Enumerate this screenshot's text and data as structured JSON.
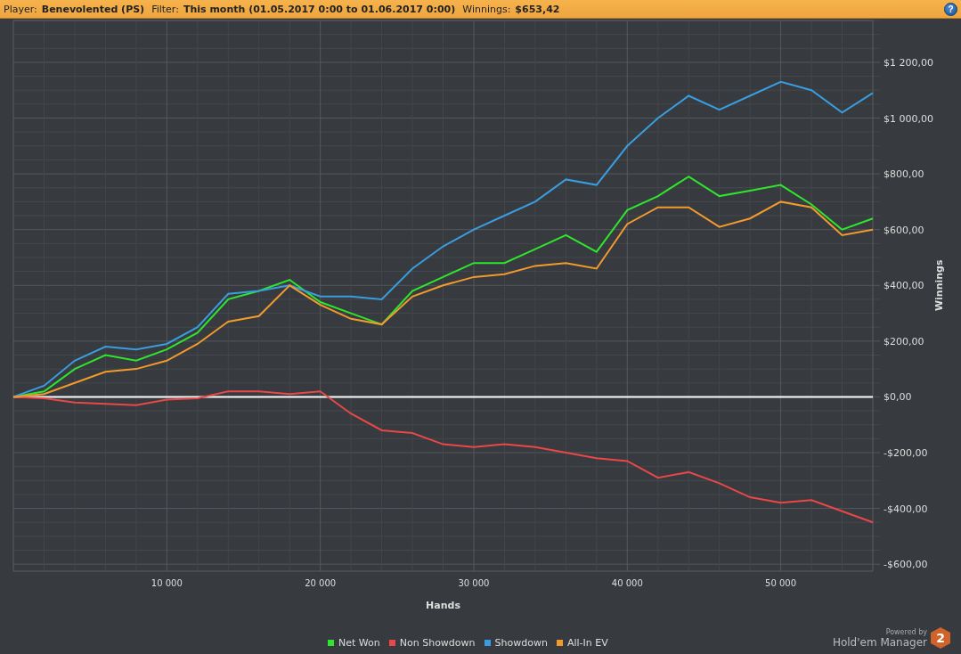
{
  "header": {
    "fields": [
      {
        "label": "Player:",
        "value": "Benevolented (PS)"
      },
      {
        "label": "Filter:",
        "value": "This month (01.05.2017 0:00 to 01.06.2017 0:00)"
      },
      {
        "label": "Winnings:",
        "value": "$653,42"
      }
    ],
    "help": "?"
  },
  "chart": {
    "chart_data": {
      "type": "line",
      "xlabel": "Hands",
      "ylabel": "Winnings",
      "x": [
        0,
        2000,
        4000,
        6000,
        8000,
        10000,
        12000,
        14000,
        16000,
        18000,
        20000,
        22000,
        24000,
        26000,
        28000,
        30000,
        32000,
        34000,
        36000,
        38000,
        40000,
        42000,
        44000,
        46000,
        48000,
        50000,
        52000,
        54000,
        56000
      ],
      "series": [
        {
          "name": "Net Won",
          "color": "#2ee62e",
          "values": [
            0,
            20,
            100,
            150,
            130,
            170,
            230,
            350,
            380,
            420,
            340,
            300,
            260,
            380,
            430,
            480,
            480,
            530,
            580,
            520,
            670,
            720,
            790,
            720,
            740,
            760,
            690,
            600,
            640
          ]
        },
        {
          "name": "Non Showdown",
          "color": "#e84848",
          "values": [
            0,
            -5,
            -20,
            -25,
            -30,
            -10,
            -5,
            20,
            20,
            10,
            20,
            -60,
            -120,
            -130,
            -170,
            -180,
            -170,
            -180,
            -200,
            -220,
            -230,
            -290,
            -270,
            -310,
            -360,
            -380,
            -370,
            -410,
            -450
          ]
        },
        {
          "name": "Showdown",
          "color": "#3a9de0",
          "values": [
            0,
            40,
            130,
            180,
            170,
            190,
            250,
            370,
            380,
            400,
            360,
            360,
            350,
            460,
            540,
            600,
            650,
            700,
            780,
            760,
            900,
            1000,
            1080,
            1030,
            1080,
            1130,
            1100,
            1020,
            1090
          ]
        },
        {
          "name": "All-In EV",
          "color": "#f39a2e",
          "values": [
            0,
            10,
            50,
            90,
            100,
            130,
            190,
            270,
            290,
            400,
            330,
            280,
            260,
            360,
            400,
            430,
            440,
            470,
            480,
            460,
            620,
            680,
            680,
            610,
            640,
            700,
            680,
            580,
            600
          ]
        }
      ],
      "grid": true,
      "xlim": [
        0,
        56000
      ],
      "ylim": [
        -625,
        1350
      ],
      "xticks": [
        {
          "value": 10000,
          "label": "10 000"
        },
        {
          "value": 20000,
          "label": "20 000"
        },
        {
          "value": 30000,
          "label": "30 000"
        },
        {
          "value": 40000,
          "label": "40 000"
        },
        {
          "value": 50000,
          "label": "50 000"
        }
      ],
      "yticks": [
        {
          "value": 1200,
          "label": "$1 200,00"
        },
        {
          "value": 1000,
          "label": "$1 000,00"
        },
        {
          "value": 800,
          "label": "$800,00"
        },
        {
          "value": 600,
          "label": "$600,00"
        },
        {
          "value": 400,
          "label": "$400,00"
        },
        {
          "value": 200,
          "label": "$200,00"
        },
        {
          "value": 0,
          "label": "$0,00"
        },
        {
          "value": -200,
          "label": "-$200,00"
        },
        {
          "value": -400,
          "label": "-$400,00"
        },
        {
          "value": -600,
          "label": "-$600,00"
        }
      ]
    }
  },
  "branding": {
    "powered_by": "Powered by",
    "product": "Hold'em Manager",
    "logo": "2"
  }
}
